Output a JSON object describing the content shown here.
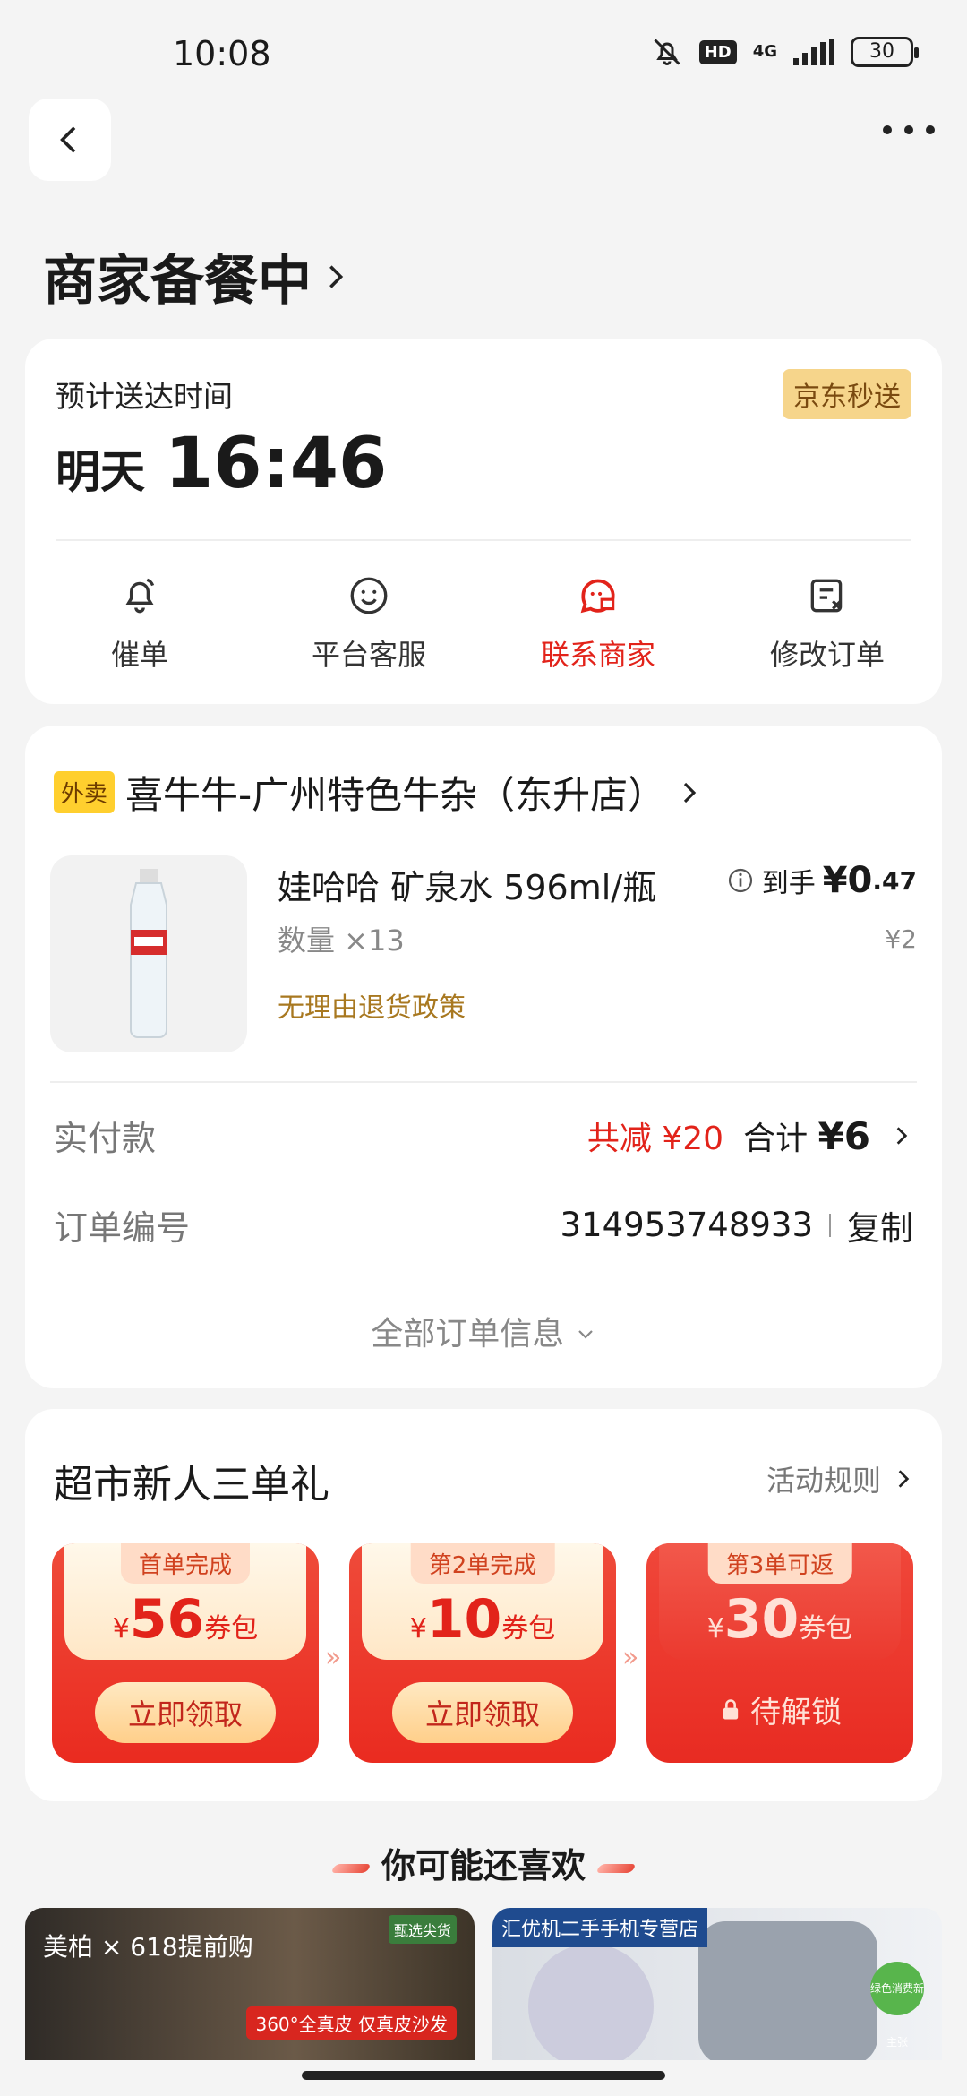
{
  "status_bar": {
    "time": "10:08",
    "hd": "HD",
    "network": "4G",
    "battery": "30"
  },
  "header": {
    "title": "商家备餐中"
  },
  "delivery": {
    "eta_label": "预计送达时间",
    "service_badge": "京东秒送",
    "eta_day": "明天",
    "eta_time": "16:46",
    "actions": [
      {
        "label": "催单",
        "icon": "bell-icon"
      },
      {
        "label": "平台客服",
        "icon": "smile-chat-icon"
      },
      {
        "label": "联系商家",
        "icon": "store-chat-icon"
      },
      {
        "label": "修改订单",
        "icon": "edit-order-icon"
      }
    ]
  },
  "order": {
    "tag": "外卖",
    "store_name": "喜牛牛-广州特色牛杂（东升店）",
    "product": {
      "name": "娃哈哈 矿泉水 596ml/瓶",
      "quantity": "数量 ×13",
      "policy": "无理由退货政策",
      "final_label": "到手",
      "final_price_int": "¥0",
      "final_price_dec": ".47",
      "original_price": "¥2"
    },
    "paid_label": "实付款",
    "reduce_text": "共减 ¥20",
    "total_label": "合计",
    "total_value": "¥6",
    "order_no_label": "订单编号",
    "order_no": "314953748933",
    "copy_label": "复制",
    "all_info": "全部订单信息"
  },
  "promo": {
    "title": "超市新人三单礼",
    "rules": "活动规则",
    "coupons": [
      {
        "tag": "首单完成",
        "currency": "¥",
        "amount": "56",
        "unit": "券包",
        "button": "立即领取"
      },
      {
        "tag": "第2单完成",
        "currency": "¥",
        "amount": "10",
        "unit": "券包",
        "button": "立即领取"
      },
      {
        "tag": "第3单可返",
        "currency": "¥",
        "amount": "30",
        "unit": "券包",
        "status": "待解锁"
      }
    ]
  },
  "recommend": {
    "title": "你可能还喜欢",
    "ad1": {
      "brand": "美柏 × 618提前购",
      "badge": "甄选尖货",
      "promo": "360°全真皮 仅真皮沙发"
    },
    "ad2": {
      "banner": "汇优机二手手机专营店",
      "badge": "绿色消费新主张"
    }
  }
}
